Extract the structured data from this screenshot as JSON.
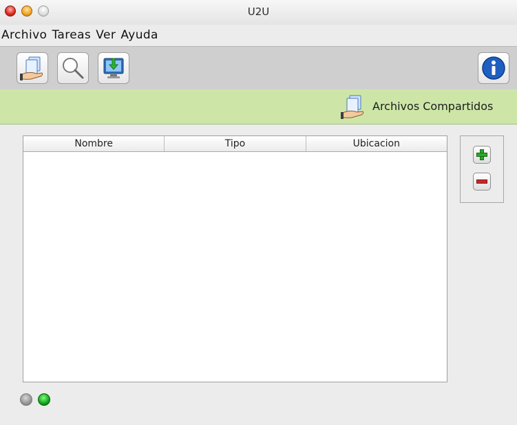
{
  "window": {
    "title": "U2U"
  },
  "menu": {
    "items": [
      "Archivo",
      "Tareas",
      "Ver",
      "Ayuda"
    ]
  },
  "toolbar": {
    "buttons": [
      {
        "name": "shared-files",
        "icon": "shared-files-icon"
      },
      {
        "name": "search",
        "icon": "magnifier-icon"
      },
      {
        "name": "downloads",
        "icon": "download-monitor-icon"
      },
      {
        "name": "info",
        "icon": "info-icon"
      }
    ]
  },
  "section": {
    "title": "Archivos Compartidos",
    "icon": "shared-files-icon",
    "color": "#cde6a8"
  },
  "table": {
    "columns": [
      "Nombre",
      "Tipo",
      "Ubicacion"
    ],
    "rows": []
  },
  "side_panel": {
    "buttons": [
      {
        "name": "add",
        "icon": "plus-icon",
        "color": "#2ea62e"
      },
      {
        "name": "remove",
        "icon": "minus-icon",
        "color": "#c62828"
      }
    ]
  },
  "status": {
    "indicators": [
      {
        "state": "off",
        "color": "#8a8a8a"
      },
      {
        "state": "on",
        "color": "#0a9a12"
      }
    ]
  }
}
